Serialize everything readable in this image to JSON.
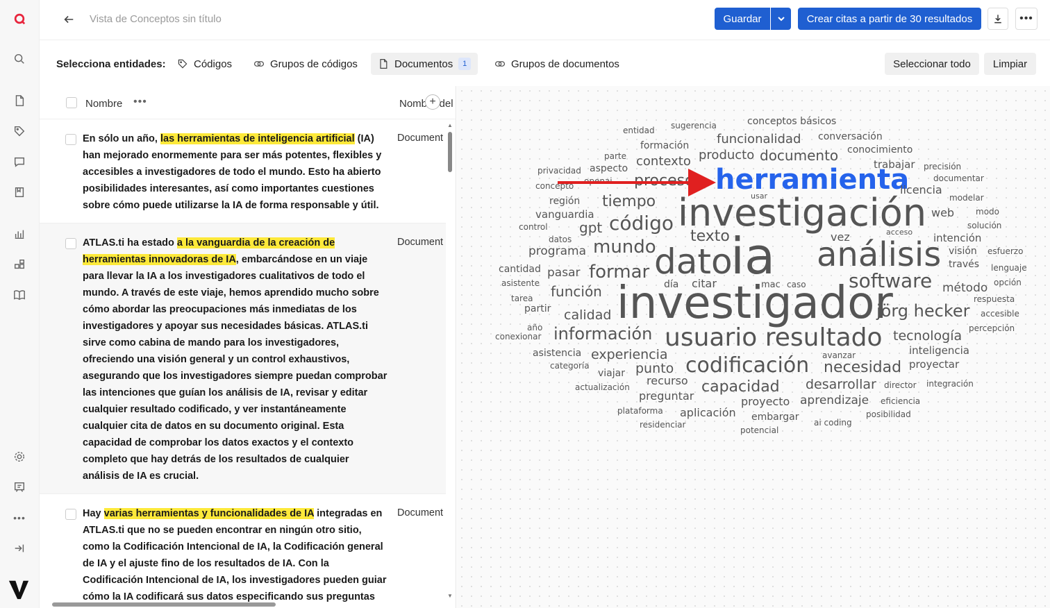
{
  "header": {
    "title": "Vista de Conceptos sin título",
    "save_label": "Guardar",
    "create_quotes_label": "Crear citas a partir de 30 resultados",
    "more_label": "•••"
  },
  "entities": {
    "label": "Selecciona entidades:",
    "tabs": [
      {
        "label": "Códigos"
      },
      {
        "label": "Grupos de códigos"
      },
      {
        "label": "Documentos",
        "count": "1"
      },
      {
        "label": "Grupos de documentos"
      }
    ],
    "select_all_label": "Seleccionar todo",
    "clear_label": "Limpiar"
  },
  "list": {
    "col_name": "Nombre",
    "col_dots": "•••",
    "col_doc": "Nombre del",
    "rows": [
      {
        "doc": "Document",
        "pre": "En sólo un año, ",
        "hl": "las herramientas de inteligencia artificial",
        "post": " (IA) han mejorado enormemente para ser más potentes, flexibles y accesibles a investigadores de todo el mundo. Esto ha abierto posibilidades interesantes, así como importantes cuestiones sobre cómo puede utilizarse la IA de forma responsable y útil."
      },
      {
        "doc": "Document",
        "pre": "ATLAS.ti ha estado ",
        "hl": "a la vanguardia de la creación de herramientas innovadoras de IA",
        "post": ", embarcándose en un viaje para llevar la IA a los investigadores cualitativos de todo el mundo. A través de este viaje, hemos aprendido mucho sobre cómo abordar las preocupaciones más inmediatas de los investigadores y apoyar sus necesidades básicas. ATLAS.ti sirve como cabina de mando para los investigadores, ofreciendo una visión general y un control exhaustivos, asegurando que los investigadores siempre puedan comprobar las intenciones que guían los análisis de IA, revisar y editar cualquier resultado codificado, y ver instantáneamente cualquier cita de datos en su documento original. Esta capacidad de comprobar los datos exactos y el contexto completo que hay detrás de los resultados de cualquier análisis de IA es crucial."
      },
      {
        "doc": "Document",
        "pre": "Hay ",
        "hl": "varias herramientas y funcionalidades de IA",
        "post": " integradas en ATLAS.ti que no se pueden encontrar en ningún otro sitio, como la Codificación Intencional de IA, la Codificación general de IA y el ajuste fino de los resultados de IA. Con la Codificación Intencional de IA, los investigadores pueden guiar cómo la IA codificará sus datos especificando sus preguntas de"
      }
    ]
  },
  "colors": {
    "primary": "#1f5fd1",
    "highlight": "#fde93a",
    "word": "#555555",
    "selected_word": "#2563eb",
    "arrow": "#e02020"
  },
  "cloud": {
    "selected": "herramienta",
    "words": [
      {
        "t": "conceptos básicos",
        "s": 14
      },
      {
        "t": "entidad",
        "s": 12
      },
      {
        "t": "sugerencia",
        "s": 12
      },
      {
        "t": "funcionalidad",
        "s": 18
      },
      {
        "t": "conversación",
        "s": 14
      },
      {
        "t": "formación",
        "s": 14
      },
      {
        "t": "parte",
        "s": 12
      },
      {
        "t": "producto",
        "s": 18
      },
      {
        "t": "documento",
        "s": 20
      },
      {
        "t": "conocimiento",
        "s": 14
      },
      {
        "t": "privacidad",
        "s": 12
      },
      {
        "t": "aspecto",
        "s": 14
      },
      {
        "t": "contexto",
        "s": 18
      },
      {
        "t": "trabajar",
        "s": 15
      },
      {
        "t": "precisión",
        "s": 12
      },
      {
        "t": "concepto",
        "s": 12
      },
      {
        "t": "openai",
        "s": 12
      },
      {
        "t": "proceso",
        "s": 22
      },
      {
        "t": "documentar",
        "s": 12
      },
      {
        "t": "herramienta",
        "s": 40
      },
      {
        "t": "licencia",
        "s": 16
      },
      {
        "t": "usar",
        "s": 11
      },
      {
        "t": "región",
        "s": 14
      },
      {
        "t": "tiempo",
        "s": 22
      },
      {
        "t": "modelar",
        "s": 12
      },
      {
        "t": "investigación",
        "s": 54
      },
      {
        "t": "vanguardia",
        "s": 15
      },
      {
        "t": "web",
        "s": 16
      },
      {
        "t": "modo",
        "s": 12
      },
      {
        "t": "control",
        "s": 12
      },
      {
        "t": "gpt",
        "s": 20
      },
      {
        "t": "código",
        "s": 28
      },
      {
        "t": "solución",
        "s": 12
      },
      {
        "t": "acceso",
        "s": 11
      },
      {
        "t": "texto",
        "s": 22
      },
      {
        "t": "vez",
        "s": 16
      },
      {
        "t": "intención",
        "s": 15
      },
      {
        "t": "datos",
        "s": 12
      },
      {
        "t": "programa",
        "s": 17
      },
      {
        "t": "mundo",
        "s": 26
      },
      {
        "t": "ia",
        "s": 72
      },
      {
        "t": "análisis",
        "s": 48
      },
      {
        "t": "visión",
        "s": 14
      },
      {
        "t": "esfuerzo",
        "s": 12
      },
      {
        "t": "dato",
        "s": 50
      },
      {
        "t": "través",
        "s": 14
      },
      {
        "t": "lenguaje",
        "s": 12
      },
      {
        "t": "cantidad",
        "s": 14
      },
      {
        "t": "pasar",
        "s": 17
      },
      {
        "t": "formar",
        "s": 26
      },
      {
        "t": "software",
        "s": 28
      },
      {
        "t": "asistente",
        "s": 12
      },
      {
        "t": "día",
        "s": 14
      },
      {
        "t": "citar",
        "s": 16
      },
      {
        "t": "mac",
        "s": 13
      },
      {
        "t": "caso",
        "s": 12
      },
      {
        "t": "método",
        "s": 17
      },
      {
        "t": "opción",
        "s": 12
      },
      {
        "t": "función",
        "s": 20
      },
      {
        "t": "investigador",
        "s": 64
      },
      {
        "t": "tarea",
        "s": 12
      },
      {
        "t": "respuesta",
        "s": 12
      },
      {
        "t": "partir",
        "s": 14
      },
      {
        "t": "jörg hecker",
        "s": 24
      },
      {
        "t": "accesible",
        "s": 12
      },
      {
        "t": "calidad",
        "s": 19
      },
      {
        "t": "año",
        "s": 12
      },
      {
        "t": "percepción",
        "s": 12
      },
      {
        "t": "información",
        "s": 24
      },
      {
        "t": "usuario resultado",
        "s": 36
      },
      {
        "t": "tecnología",
        "s": 19
      },
      {
        "t": "conexionar",
        "s": 12
      },
      {
        "t": "inteligencia",
        "s": 15
      },
      {
        "t": "asistencia",
        "s": 14
      },
      {
        "t": "experiencia",
        "s": 19
      },
      {
        "t": "avanzar",
        "s": 12
      },
      {
        "t": "categoría",
        "s": 12
      },
      {
        "t": "codificación",
        "s": 30
      },
      {
        "t": "necesidad",
        "s": 22
      },
      {
        "t": "proyectar",
        "s": 15
      },
      {
        "t": "punto",
        "s": 19
      },
      {
        "t": "viajar",
        "s": 14
      },
      {
        "t": "recurso",
        "s": 16
      },
      {
        "t": "capacidad",
        "s": 22
      },
      {
        "t": "desarrollar",
        "s": 19
      },
      {
        "t": "director",
        "s": 12
      },
      {
        "t": "integración",
        "s": 12
      },
      {
        "t": "actualización",
        "s": 12
      },
      {
        "t": "preguntar",
        "s": 16
      },
      {
        "t": "proyecto",
        "s": 16
      },
      {
        "t": "aprendizaje",
        "s": 17
      },
      {
        "t": "eficiencia",
        "s": 12
      },
      {
        "t": "plataforma",
        "s": 12
      },
      {
        "t": "aplicación",
        "s": 16
      },
      {
        "t": "posibilidad",
        "s": 12
      },
      {
        "t": "embargar",
        "s": 14
      },
      {
        "t": "residenciar",
        "s": 12
      },
      {
        "t": "ai coding",
        "s": 12
      },
      {
        "t": "potencial",
        "s": 12
      }
    ]
  }
}
